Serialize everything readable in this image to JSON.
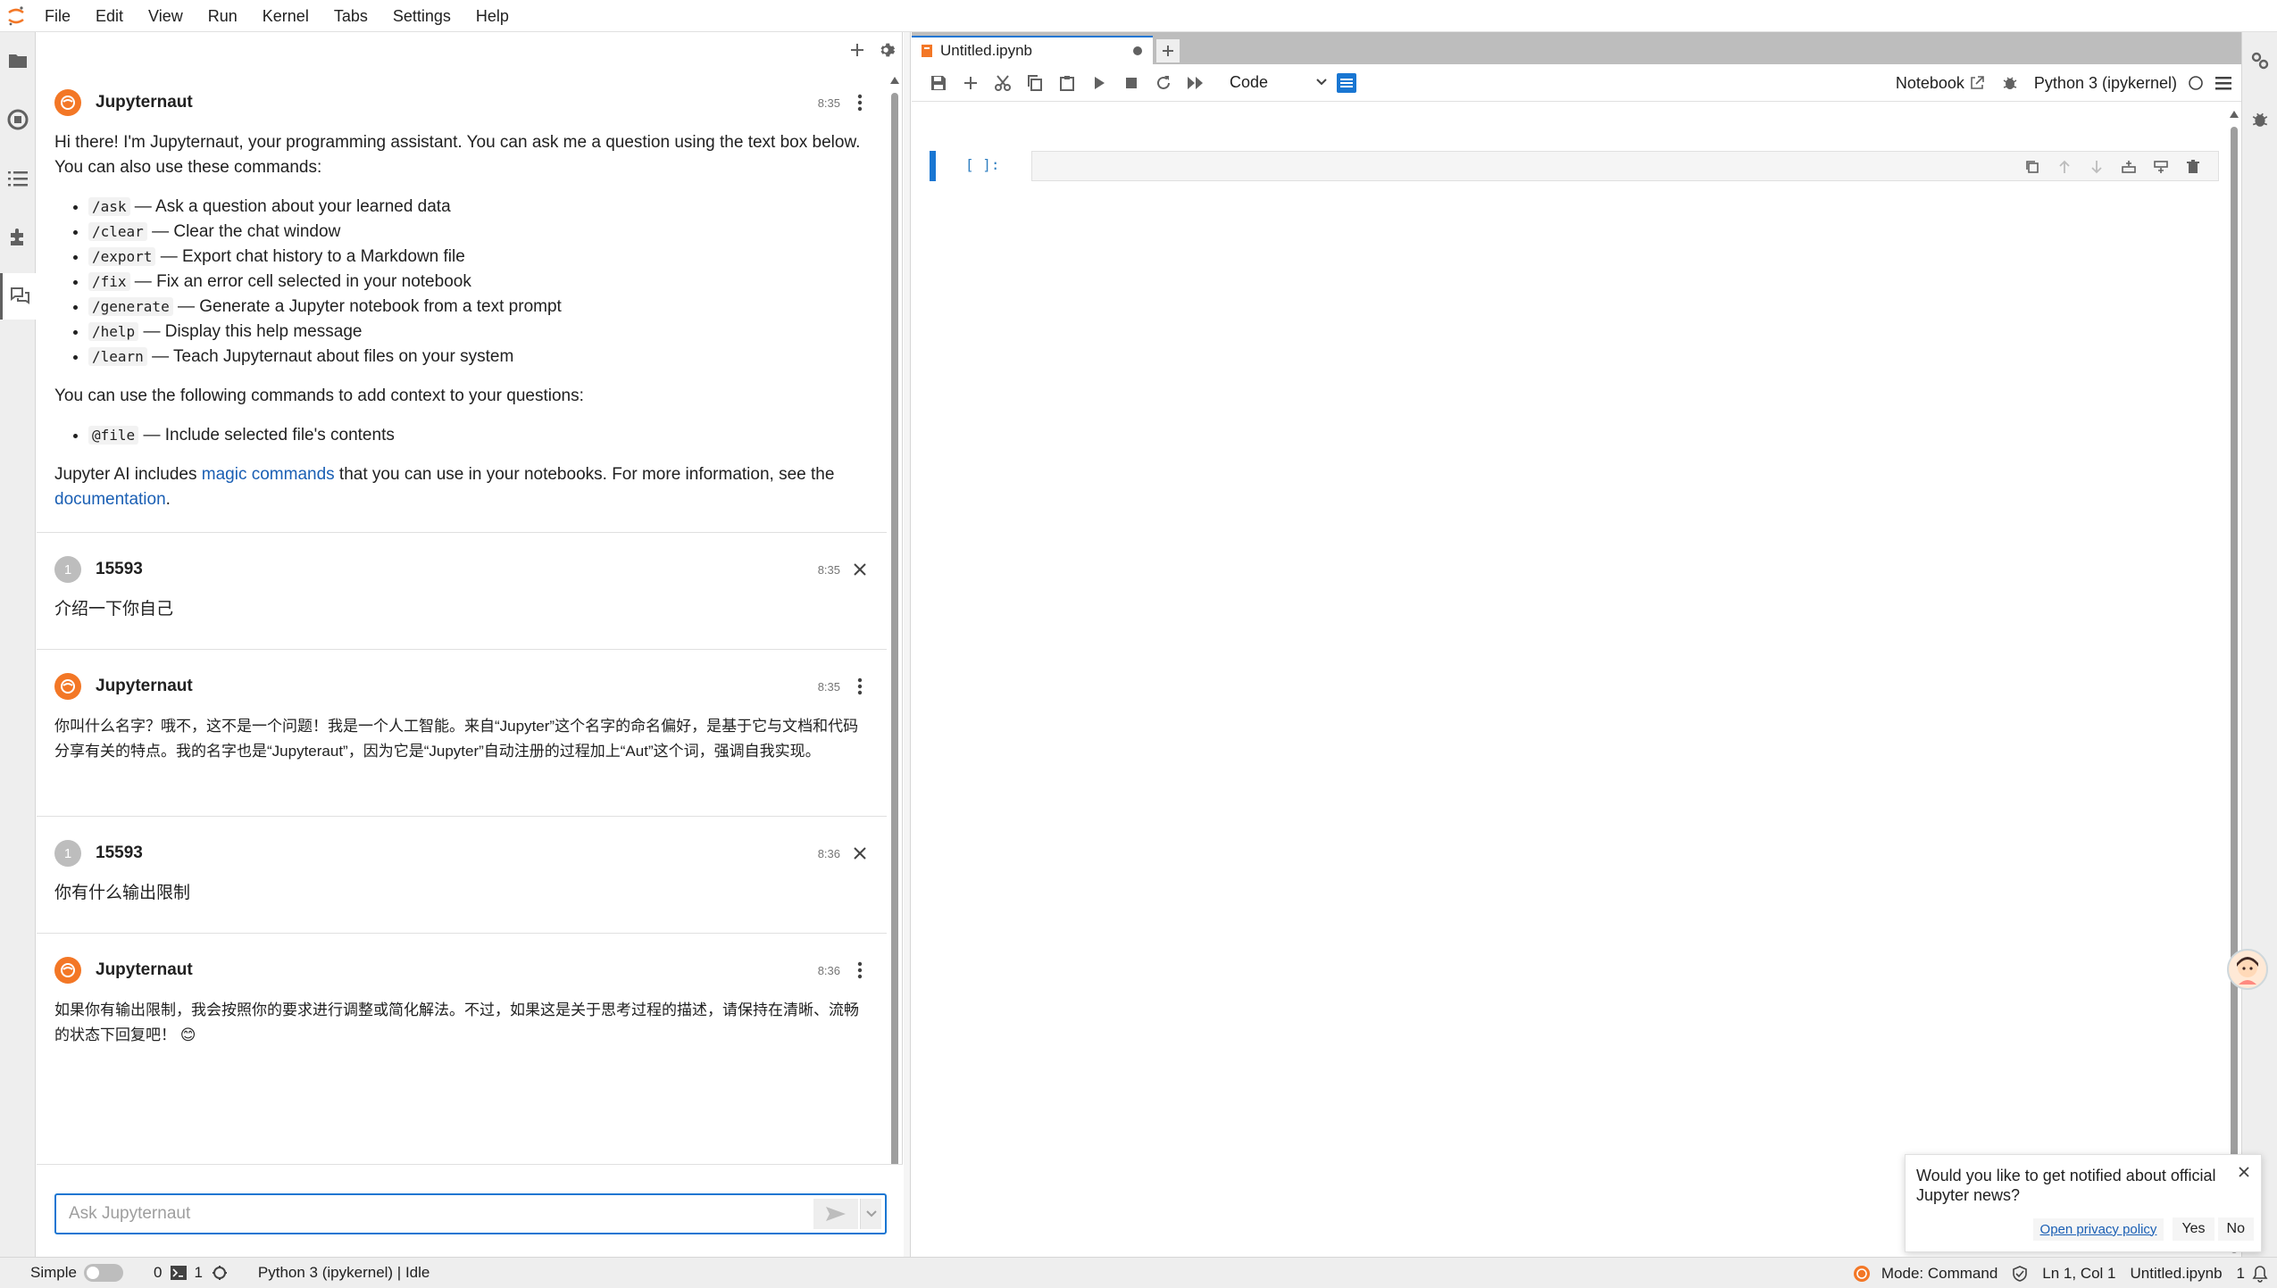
{
  "menubar": {
    "items": [
      "File",
      "Edit",
      "View",
      "Run",
      "Kernel",
      "Tabs",
      "Settings",
      "Help"
    ]
  },
  "chat": {
    "messages": [
      {
        "sender": "Jupyternaut",
        "time": "8:35",
        "intro": "Hi there! I'm Jupyternaut, your programming assistant. You can ask me a question using the text box below. You can also use these commands:",
        "commands": [
          {
            "cmd": "/ask",
            "desc": " — Ask a question about your learned data"
          },
          {
            "cmd": "/clear",
            "desc": " — Clear the chat window"
          },
          {
            "cmd": "/export",
            "desc": " — Export chat history to a Markdown file"
          },
          {
            "cmd": "/fix",
            "desc": " — Fix an error cell selected in your notebook"
          },
          {
            "cmd": "/generate",
            "desc": " — Generate a Jupyter notebook from a text prompt"
          },
          {
            "cmd": "/help",
            "desc": " — Display this help message"
          },
          {
            "cmd": "/learn",
            "desc": " — Teach Jupyternaut about files on your system"
          }
        ],
        "context_intro": "You can use the following commands to add context to your questions:",
        "context_commands": [
          {
            "cmd": "@file",
            "desc": " — Include selected file's contents"
          }
        ],
        "magic_prefix": "Jupyter AI includes ",
        "magic_link": "magic commands",
        "magic_mid": " that you can use in your notebooks. For more information, see the ",
        "doc_link": "documentation",
        "magic_suffix": "."
      },
      {
        "sender": "15593",
        "avatar_initial": "1",
        "time": "8:35",
        "text": "介绍一下你自己"
      },
      {
        "sender": "Jupyternaut",
        "time": "8:35",
        "text": "你叫什么名字？哦不，这不是一个问题！我是一个人工智能。来自“Jupyter”这个名字的命名偏好，是基于它与文档和代码分享有关的特点。我的名字也是“Jupyteraut”，因为它是“Jupyter”自动注册的过程加上“Aut”这个词，强调自我实现。"
      },
      {
        "sender": "15593",
        "avatar_initial": "1",
        "time": "8:36",
        "text": "你有什么输出限制"
      },
      {
        "sender": "Jupyternaut",
        "time": "8:36",
        "text": "如果你有输出限制，我会按照你的要求进行调整或简化解法。不过，如果这是关于思考过程的描述，请保持在清晰、流畅的状态下回复吧！ 😊"
      }
    ],
    "input_placeholder": "Ask Jupyternaut"
  },
  "notebook": {
    "tab_title": "Untitled.ipynb",
    "cell_type": "Code",
    "toolbar_notebook_label": "Notebook",
    "kernel_name": "Python 3 (ipykernel)",
    "cell_prompt": "[ ]:"
  },
  "toast": {
    "message": "Would you like to get notified about official Jupyter news?",
    "privacy_link": "Open privacy policy",
    "yes": "Yes",
    "no": "No"
  },
  "statusbar": {
    "mode_label": "Simple",
    "terminals": "0",
    "kernels": "1",
    "kernel_status": "Python 3 (ipykernel) | Idle",
    "mode": "Mode: Command",
    "position": "Ln 1, Col 1",
    "filename": "Untitled.ipynb",
    "notifications": "1"
  },
  "colors": {
    "accent": "#1976d2",
    "jupyter_orange": "#f37726"
  }
}
